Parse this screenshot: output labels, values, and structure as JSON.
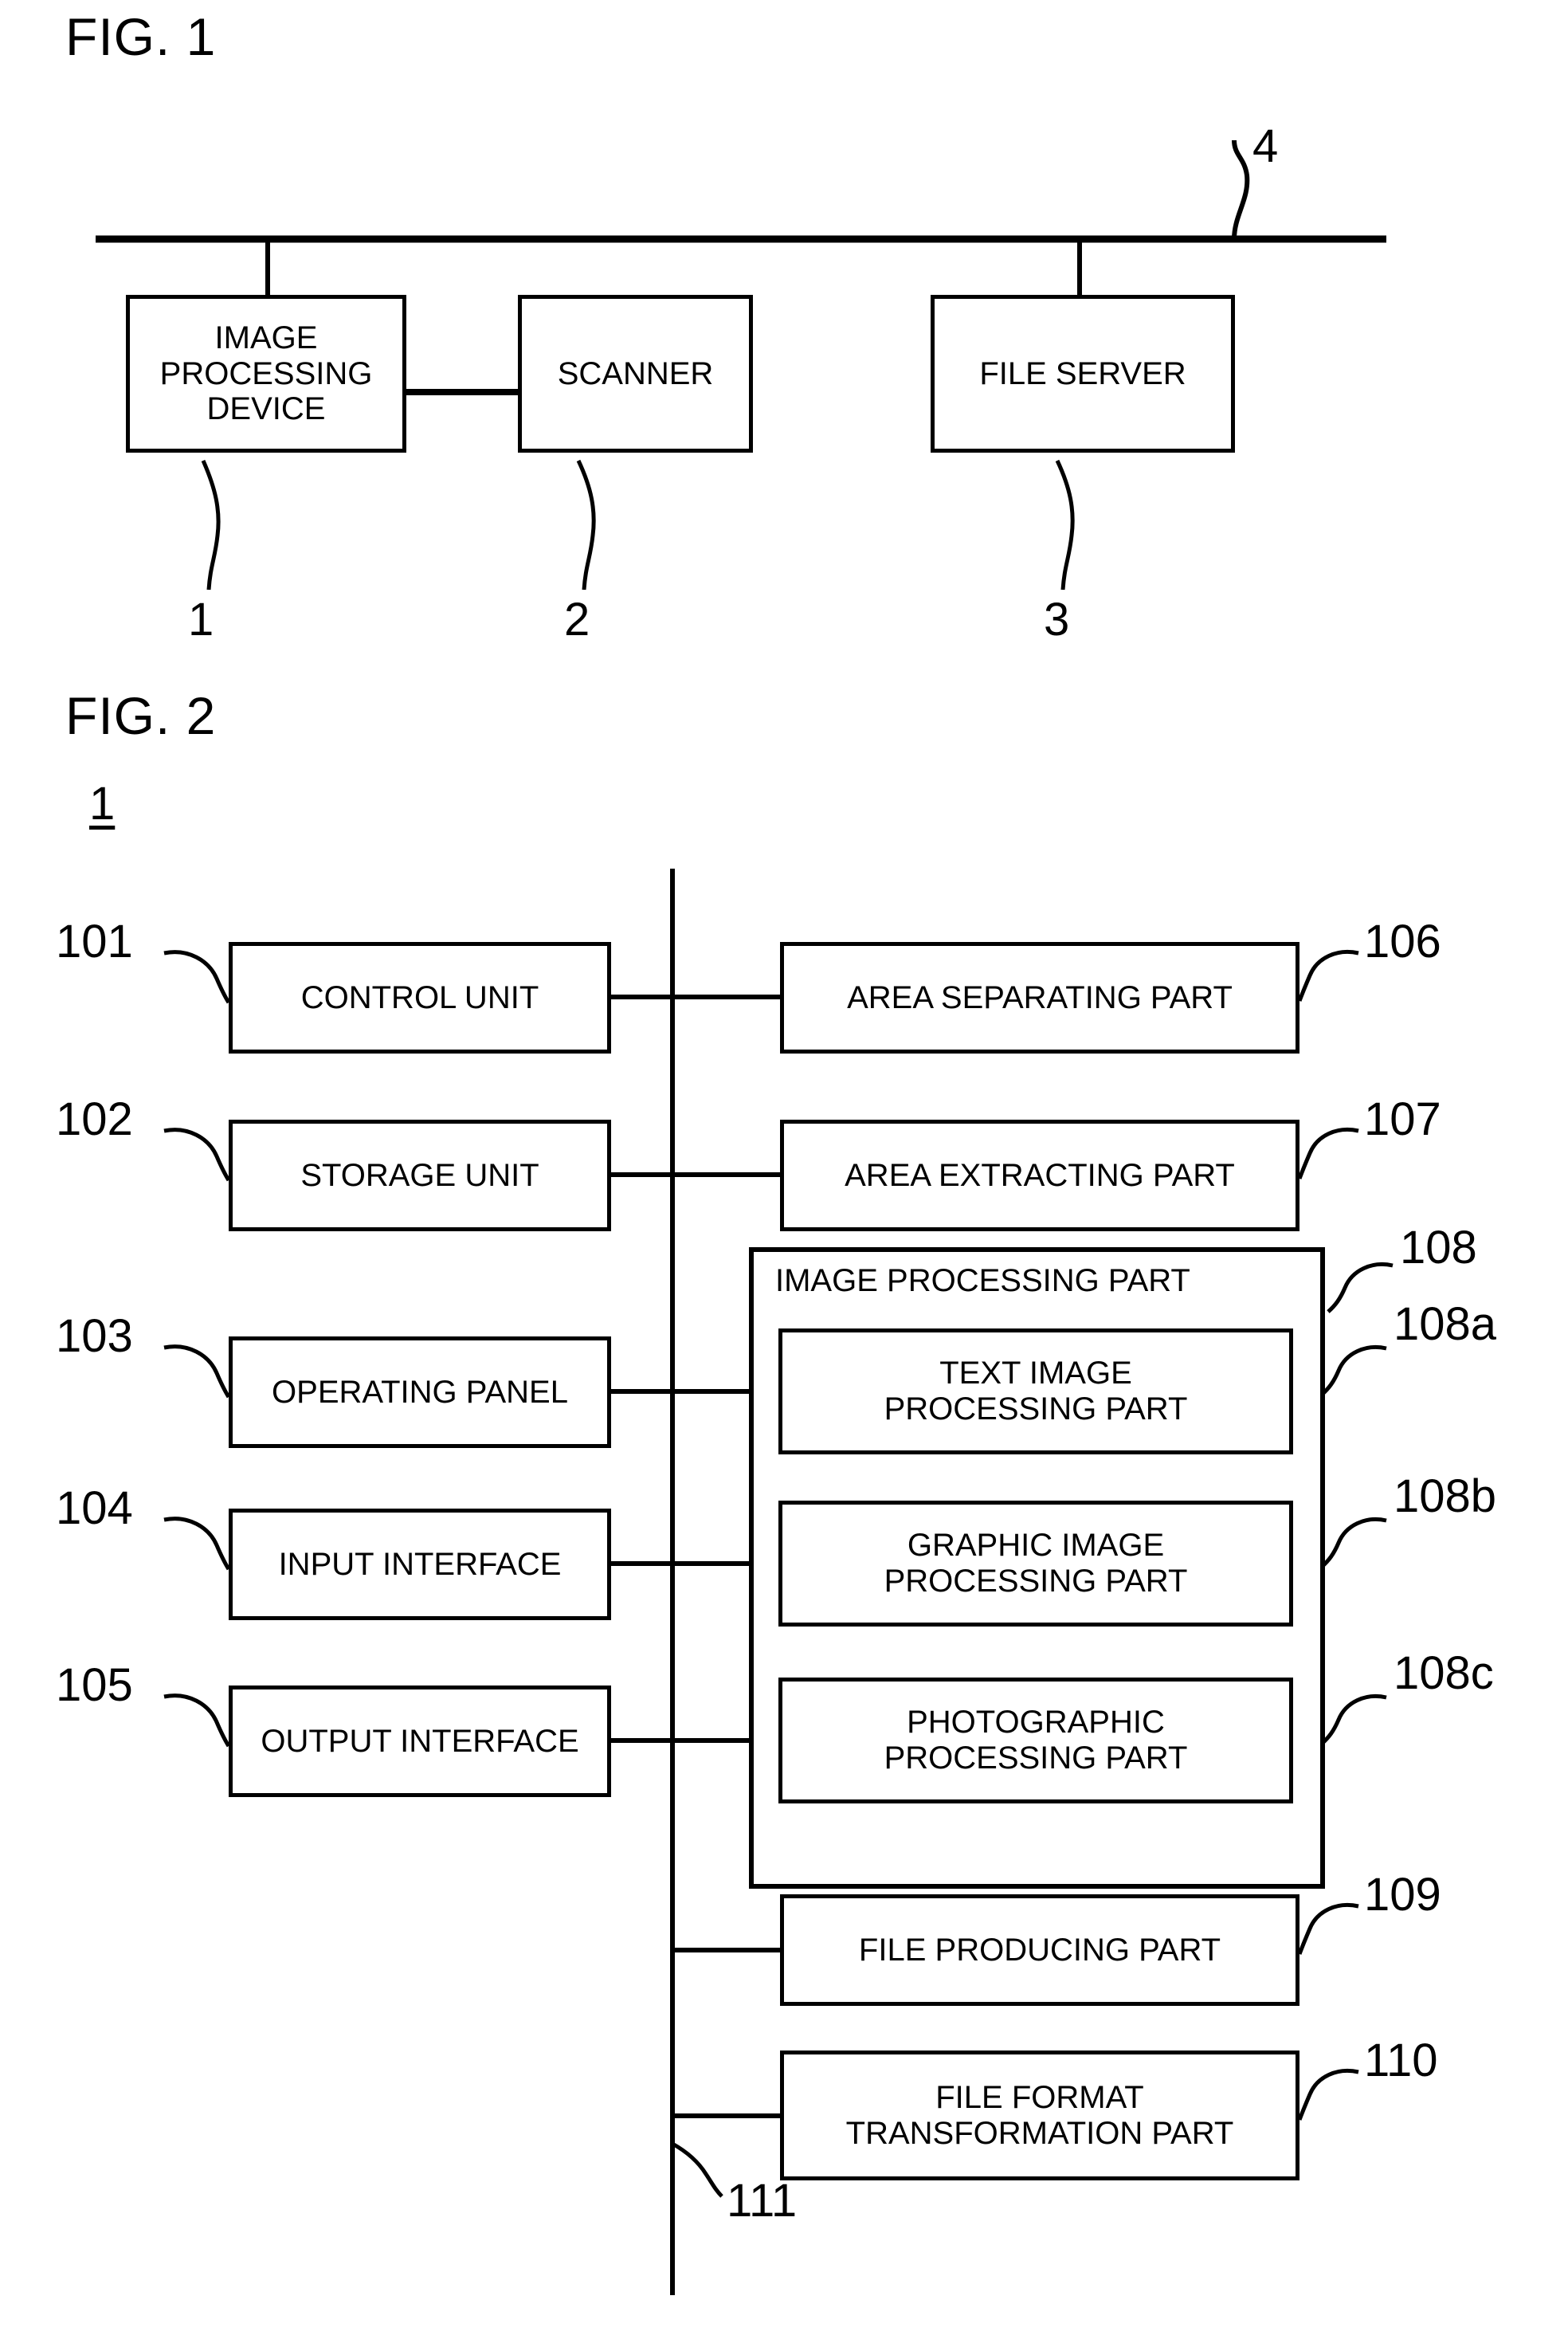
{
  "document": {
    "kind": "patent-drawing-sheet",
    "figures": [
      {
        "id": "fig1",
        "title": "FIG. 1",
        "network_bus_ref": "4",
        "nodes": [
          {
            "ref": "1",
            "label_lines": [
              "IMAGE",
              "PROCESSING",
              "DEVICE"
            ],
            "on_bus": true
          },
          {
            "ref": "2",
            "label_lines": [
              "SCANNER"
            ],
            "on_bus": false
          },
          {
            "ref": "3",
            "label_lines": [
              "FILE SERVER"
            ],
            "on_bus": true
          }
        ],
        "links": [
          {
            "from": "1",
            "to": "2",
            "type": "direct"
          },
          {
            "from": "1",
            "to": "4",
            "type": "bus-drop"
          },
          {
            "from": "3",
            "to": "4",
            "type": "bus-drop"
          }
        ]
      },
      {
        "id": "fig2",
        "title": "FIG. 2",
        "device_ref": "1",
        "internal_bus_ref": "111",
        "left_column": [
          {
            "ref": "101",
            "label_lines": [
              "CONTROL UNIT"
            ]
          },
          {
            "ref": "102",
            "label_lines": [
              "STORAGE UNIT"
            ]
          },
          {
            "ref": "103",
            "label_lines": [
              "OPERATING PANEL"
            ]
          },
          {
            "ref": "104",
            "label_lines": [
              "INPUT INTERFACE"
            ]
          },
          {
            "ref": "105",
            "label_lines": [
              "OUTPUT INTERFACE"
            ]
          }
        ],
        "right_column": [
          {
            "ref": "106",
            "label_lines": [
              "AREA SEPARATING PART"
            ]
          },
          {
            "ref": "107",
            "label_lines": [
              "AREA EXTRACTING PART"
            ]
          },
          {
            "ref": "109",
            "label_lines": [
              "FILE PRODUCING PART"
            ]
          },
          {
            "ref": "110",
            "label_lines": [
              "FILE FORMAT",
              "TRANSFORMATION PART"
            ]
          }
        ],
        "group": {
          "ref": "108",
          "title": "IMAGE PROCESSING PART",
          "children": [
            {
              "ref": "108a",
              "label_lines": [
                "TEXT IMAGE",
                "PROCESSING PART"
              ]
            },
            {
              "ref": "108b",
              "label_lines": [
                "GRAPHIC IMAGE",
                "PROCESSING PART"
              ]
            },
            {
              "ref": "108c",
              "label_lines": [
                "PHOTOGRAPHIC",
                "PROCESSING PART"
              ]
            }
          ]
        }
      }
    ]
  },
  "fig1": {
    "title": "FIG. 1",
    "bus_ref": "4",
    "box1_line1": "IMAGE",
    "box1_line2": "PROCESSING",
    "box1_line3": "DEVICE",
    "box1_ref": "1",
    "box2_label": "SCANNER",
    "box2_ref": "2",
    "box3_label": "FILE SERVER",
    "box3_ref": "3"
  },
  "fig2": {
    "title": "FIG. 2",
    "device_ref": "1",
    "bus_ref": "111",
    "left": [
      {
        "ref": "101",
        "label": "CONTROL UNIT"
      },
      {
        "ref": "102",
        "label": "STORAGE UNIT"
      },
      {
        "ref": "103",
        "label": "OPERATING PANEL"
      },
      {
        "ref": "104",
        "label": "INPUT INTERFACE"
      },
      {
        "ref": "105",
        "label": "OUTPUT INTERFACE"
      }
    ],
    "right": [
      {
        "ref": "106",
        "label": "AREA SEPARATING PART"
      },
      {
        "ref": "107",
        "label": "AREA EXTRACTING PART"
      }
    ],
    "group": {
      "ref": "108",
      "title": "IMAGE PROCESSING PART",
      "items": [
        {
          "ref": "108a",
          "line1": "TEXT IMAGE",
          "line2": "PROCESSING PART"
        },
        {
          "ref": "108b",
          "line1": "GRAPHIC IMAGE",
          "line2": "PROCESSING PART"
        },
        {
          "ref": "108c",
          "line1": "PHOTOGRAPHIC",
          "line2": "PROCESSING PART"
        }
      ]
    },
    "bottom": [
      {
        "ref": "109",
        "line1": "FILE PRODUCING PART",
        "line2": ""
      },
      {
        "ref": "110",
        "line1": "FILE FORMAT",
        "line2": "TRANSFORMATION PART"
      }
    ]
  },
  "colors": {
    "ink": "#000000",
    "paper": "#ffffff"
  }
}
